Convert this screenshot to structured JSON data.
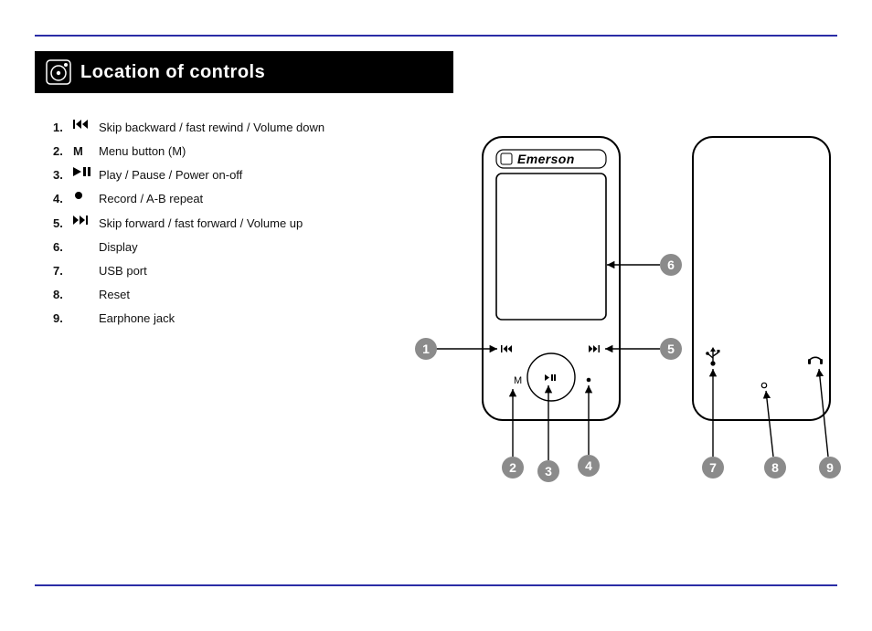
{
  "section": {
    "title": "Location of controls"
  },
  "legend": [
    {
      "num": "1.",
      "symbol": "prev",
      "text": "Skip backward / fast rewind / Volume down"
    },
    {
      "num": "2.",
      "symbol": "M",
      "text": "Menu button (M)"
    },
    {
      "num": "3.",
      "symbol": "play",
      "text": "Play / Pause / Power on-off"
    },
    {
      "num": "4.",
      "symbol": "dot",
      "text": "Record / A-B repeat"
    },
    {
      "num": "5.",
      "symbol": "next",
      "text": "Skip forward / fast forward / Volume up"
    },
    {
      "num": "6.",
      "symbol": "",
      "text": "Display"
    },
    {
      "num": "7.",
      "symbol": "",
      "text": "USB port"
    },
    {
      "num": "8.",
      "symbol": "",
      "text": "Reset"
    },
    {
      "num": "9.",
      "symbol": "",
      "text": "Earphone jack"
    }
  ],
  "device": {
    "brand": "Emerson"
  },
  "callouts": {
    "1": "1",
    "2": "2",
    "3": "3",
    "4": "4",
    "5": "5",
    "6": "6",
    "7": "7",
    "8": "8",
    "9": "9"
  }
}
